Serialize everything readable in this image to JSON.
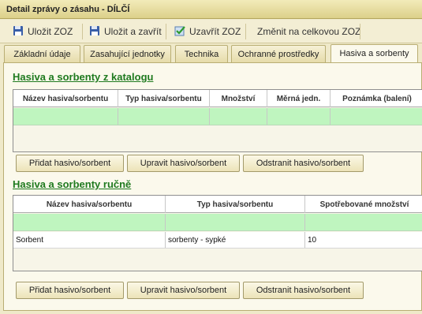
{
  "window": {
    "title": "Detail zprávy o zásahu - DÍLČÍ"
  },
  "toolbar": {
    "save_label": "Uložit ZOZ",
    "save_close_label": "Uložit a zavřít",
    "close_zoz_label": "Uzavřít ZOZ",
    "change_label": "Změnit na celkovou ZOZ"
  },
  "tabs": [
    {
      "label": "Základní údaje"
    },
    {
      "label": "Zasahující jednotky"
    },
    {
      "label": "Technika"
    },
    {
      "label": "Ochranné prostředky"
    },
    {
      "label": "Hasiva a sorbenty",
      "active": true
    }
  ],
  "catalog": {
    "title": "Hasiva a sorbenty z katalogu",
    "columns": [
      "Název hasiva/sorbentu",
      "Typ hasiva/sorbentu",
      "Množství",
      "Měrná jedn.",
      "Poznámka (balení)"
    ],
    "rows": [],
    "buttons": {
      "add": "Přidat hasivo/sorbent",
      "edit": "Upravit hasivo/sorbent",
      "remove": "Odstranit hasivo/sorbent"
    }
  },
  "manual": {
    "title": "Hasiva a sorbenty ručně",
    "columns": [
      "Název hasiva/sorbentu",
      "Typ hasiva/sorbentu",
      "Spotřebované množství"
    ],
    "rows": [
      {
        "name": "Sorbent",
        "type": "sorbenty - sypké",
        "amount": "10"
      }
    ],
    "buttons": {
      "add": "Přidat hasivo/sorbent",
      "edit": "Upravit hasivo/sorbent",
      "remove": "Odstranit hasivo/sorbent"
    }
  },
  "colors": {
    "accent": "#1f7a1f",
    "new_row": "#bff5bf",
    "background": "#efe9c9"
  }
}
